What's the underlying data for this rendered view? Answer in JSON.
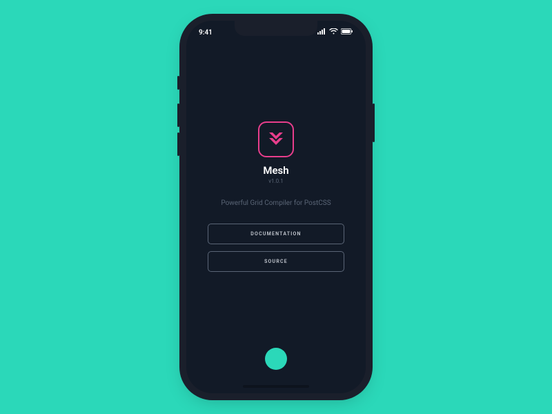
{
  "status": {
    "time": "9:41"
  },
  "app": {
    "name": "Mesh",
    "version": "v1.0.1",
    "tagline": "Powerful Grid Compiler for PostCSS"
  },
  "actions": {
    "documentation": "DOCUMENTATION",
    "source": "SOURCE"
  },
  "colors": {
    "accent": "#2bd8b9",
    "brand": "#e83e8c",
    "screen": "#121a27"
  }
}
